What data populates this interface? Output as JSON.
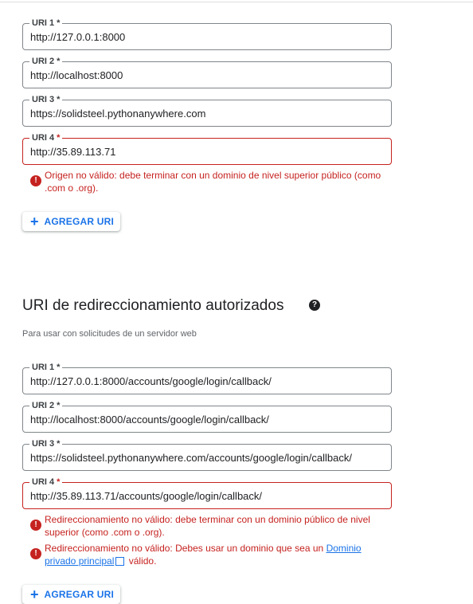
{
  "origins": {
    "fields": [
      {
        "label": "URI 1",
        "required": "*",
        "value": "http://127.0.0.1:8000"
      },
      {
        "label": "URI 2",
        "required": "*",
        "value": "http://localhost:8000"
      },
      {
        "label": "URI 3",
        "required": "*",
        "value": "https://solidsteel.pythonanywhere.com"
      },
      {
        "label": "URI 4",
        "required": "*",
        "value": "http://35.89.113.71"
      }
    ],
    "error": "Origen no válido: debe terminar con un dominio de nivel superior público (como .com o .org).",
    "add_button": "AGREGAR URI"
  },
  "redirect": {
    "title": "URI de redireccionamiento autorizados",
    "subtitle": "Para usar con solicitudes de un servidor web",
    "fields": [
      {
        "label": "URI 1",
        "required": "*",
        "value": "http://127.0.0.1:8000/accounts/google/login/callback/"
      },
      {
        "label": "URI 2",
        "required": "*",
        "value": "http://localhost:8000/accounts/google/login/callback/"
      },
      {
        "label": "URI 3",
        "required": "*",
        "value": "https://solidsteel.pythonanywhere.com/accounts/google/login/callback/"
      },
      {
        "label": "URI 4",
        "required": "*",
        "value": "http://35.89.113.71/accounts/google/login/callback/"
      }
    ],
    "error1": "Redireccionamiento no válido: debe terminar con un dominio público de nivel superior (como .com o .org).",
    "error2_prefix": "Redireccionamiento no válido: Debes usar un dominio que sea un",
    "error2_link": "Dominio privado principal",
    "error2_suffix": "válido.",
    "add_button": "AGREGAR URI"
  },
  "icons": {
    "error": "error-icon",
    "help": "help-icon",
    "add": "plus-icon",
    "external": "external-link-icon"
  },
  "colors": {
    "error": "#c5221f",
    "link": "#1a73e8",
    "border": "#80868b"
  }
}
